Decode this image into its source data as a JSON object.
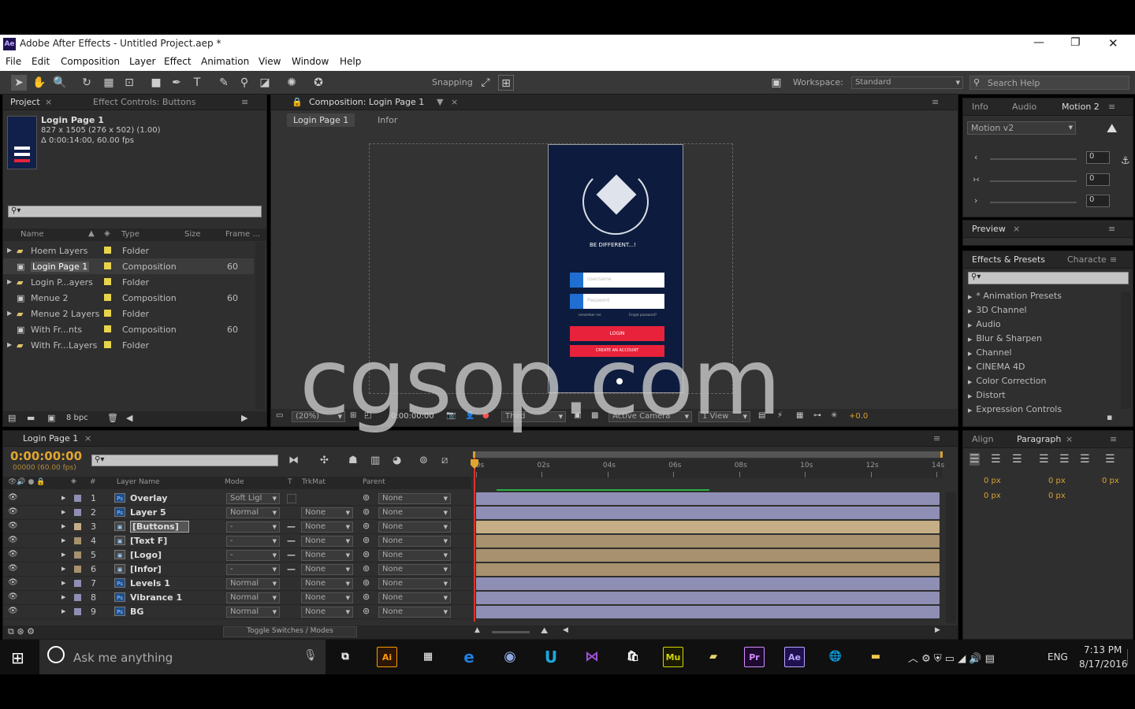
{
  "window": {
    "title": "Adobe After Effects - Untitled Project.aep *",
    "minimize": "—",
    "restore": "❐",
    "close": "✕"
  },
  "menu": [
    "File",
    "Edit",
    "Composition",
    "Layer",
    "Effect",
    "Animation",
    "View",
    "Window",
    "Help"
  ],
  "toolbar": {
    "snapping": "Snapping",
    "workspace_label": "Workspace:",
    "workspace_value": "Standard",
    "search_placeholder": "Search Help"
  },
  "project_panel": {
    "tabs": [
      "Project",
      "Effect Controls: Buttons"
    ],
    "item_name": "Login Page 1",
    "item_info1": "827 x 1505  (276 x 502) (1.00)",
    "item_info2": "Δ 0:00:14:00, 60.00 fps",
    "columns": [
      "Name",
      "Type",
      "Size",
      "Frame ..."
    ],
    "rows": [
      {
        "name": "Hoem Layers",
        "type": "Folder",
        "frame": "",
        "color": "#e8d44a"
      },
      {
        "name": "Login Page 1",
        "type": "Composition",
        "frame": "60",
        "color": "#e8d44a"
      },
      {
        "name": "Login P...ayers",
        "type": "Folder",
        "frame": "",
        "color": "#e8d44a"
      },
      {
        "name": "Menue 2",
        "type": "Composition",
        "frame": "60",
        "color": "#e8d44a"
      },
      {
        "name": "Menue 2 Layers",
        "type": "Folder",
        "frame": "",
        "color": "#e8d44a"
      },
      {
        "name": "With Fr...nts",
        "type": "Composition",
        "frame": "60",
        "color": "#e8d44a"
      },
      {
        "name": "With Fr...Layers",
        "type": "Folder",
        "frame": "",
        "color": "#e8d44a"
      }
    ],
    "bpc": "8 bpc"
  },
  "composition_panel": {
    "tab": "Composition: Login Page 1",
    "crumbs": [
      "Login Page 1",
      "Infor"
    ],
    "phone": {
      "tagline": "BE DIFFERENT...!",
      "username": "Username",
      "password": "Password",
      "remember": "remember me",
      "forgot": "Forgot password?",
      "login": "LOGIN",
      "create": "CREATE AN ACCOUNT"
    },
    "footer": {
      "zoom": "(20%)",
      "time": "0:00:00:00",
      "res": "Third",
      "camera": "Active Camera",
      "view": "1 View",
      "exposure": "+0.0"
    }
  },
  "right_panel": {
    "tabs1": [
      "Info",
      "Audio",
      "Motion 2"
    ],
    "motion_select": "Motion v2",
    "values": [
      "0",
      "0",
      "0"
    ],
    "preview": "Preview",
    "fx_tabs": [
      "Effects & Presets",
      "Characte"
    ],
    "fx_list": [
      "* Animation Presets",
      "3D Channel",
      "Audio",
      "Blur & Sharpen",
      "Channel",
      "CINEMA 4D",
      "Color Correction",
      "Distort",
      "Expression Controls"
    ],
    "align_tabs": [
      "Align",
      "Paragraph"
    ],
    "px": [
      "0 px",
      "0 px",
      "0 px",
      "0 px",
      "0 px"
    ]
  },
  "timeline": {
    "tab": "Login Page 1",
    "timecode": "0:00:00:00",
    "sub_timecode": "00000 (60.00 fps)",
    "columns": [
      "Layer Name",
      "Mode",
      "T",
      "TrkMat",
      "Parent"
    ],
    "ruler": [
      "00s",
      "02s",
      "04s",
      "06s",
      "08s",
      "10s",
      "12s",
      "14s"
    ],
    "layers": [
      {
        "num": "1",
        "name": "Overlay",
        "mode": "Soft Ligl",
        "trk": "",
        "parent": "None",
        "color": "#8f8fb5",
        "icon": "Ps"
      },
      {
        "num": "2",
        "name": "Layer 5",
        "mode": "Normal",
        "trk": "None",
        "parent": "None",
        "color": "#8f8fb5",
        "icon": "Ps"
      },
      {
        "num": "3",
        "name": "[Buttons]",
        "mode": "-",
        "trk": "None",
        "parent": "None",
        "color": "#c5ad85",
        "icon": "comp"
      },
      {
        "num": "4",
        "name": "[Text F]",
        "mode": "-",
        "trk": "None",
        "parent": "None",
        "color": "#a8916e",
        "icon": "comp"
      },
      {
        "num": "5",
        "name": "[Logo]",
        "mode": "-",
        "trk": "None",
        "parent": "None",
        "color": "#a8916e",
        "icon": "comp"
      },
      {
        "num": "6",
        "name": "[Infor]",
        "mode": "-",
        "trk": "None",
        "parent": "None",
        "color": "#a8916e",
        "icon": "comp"
      },
      {
        "num": "7",
        "name": "Levels 1",
        "mode": "Normal",
        "trk": "None",
        "parent": "None",
        "color": "#8f8fb5",
        "icon": "Ps"
      },
      {
        "num": "8",
        "name": "Vibrance 1",
        "mode": "Normal",
        "trk": "None",
        "parent": "None",
        "color": "#8f8fb5",
        "icon": "Ps"
      },
      {
        "num": "9",
        "name": "BG",
        "mode": "Normal",
        "trk": "None",
        "parent": "None",
        "color": "#8f8fb5",
        "icon": "Ps"
      }
    ],
    "toggle": "Toggle Switches / Modes"
  },
  "taskbar": {
    "search": "Ask me anything",
    "lang": "ENG",
    "time": "7:13 PM",
    "date": "8/17/2016"
  },
  "watermark": "cgsop.com"
}
